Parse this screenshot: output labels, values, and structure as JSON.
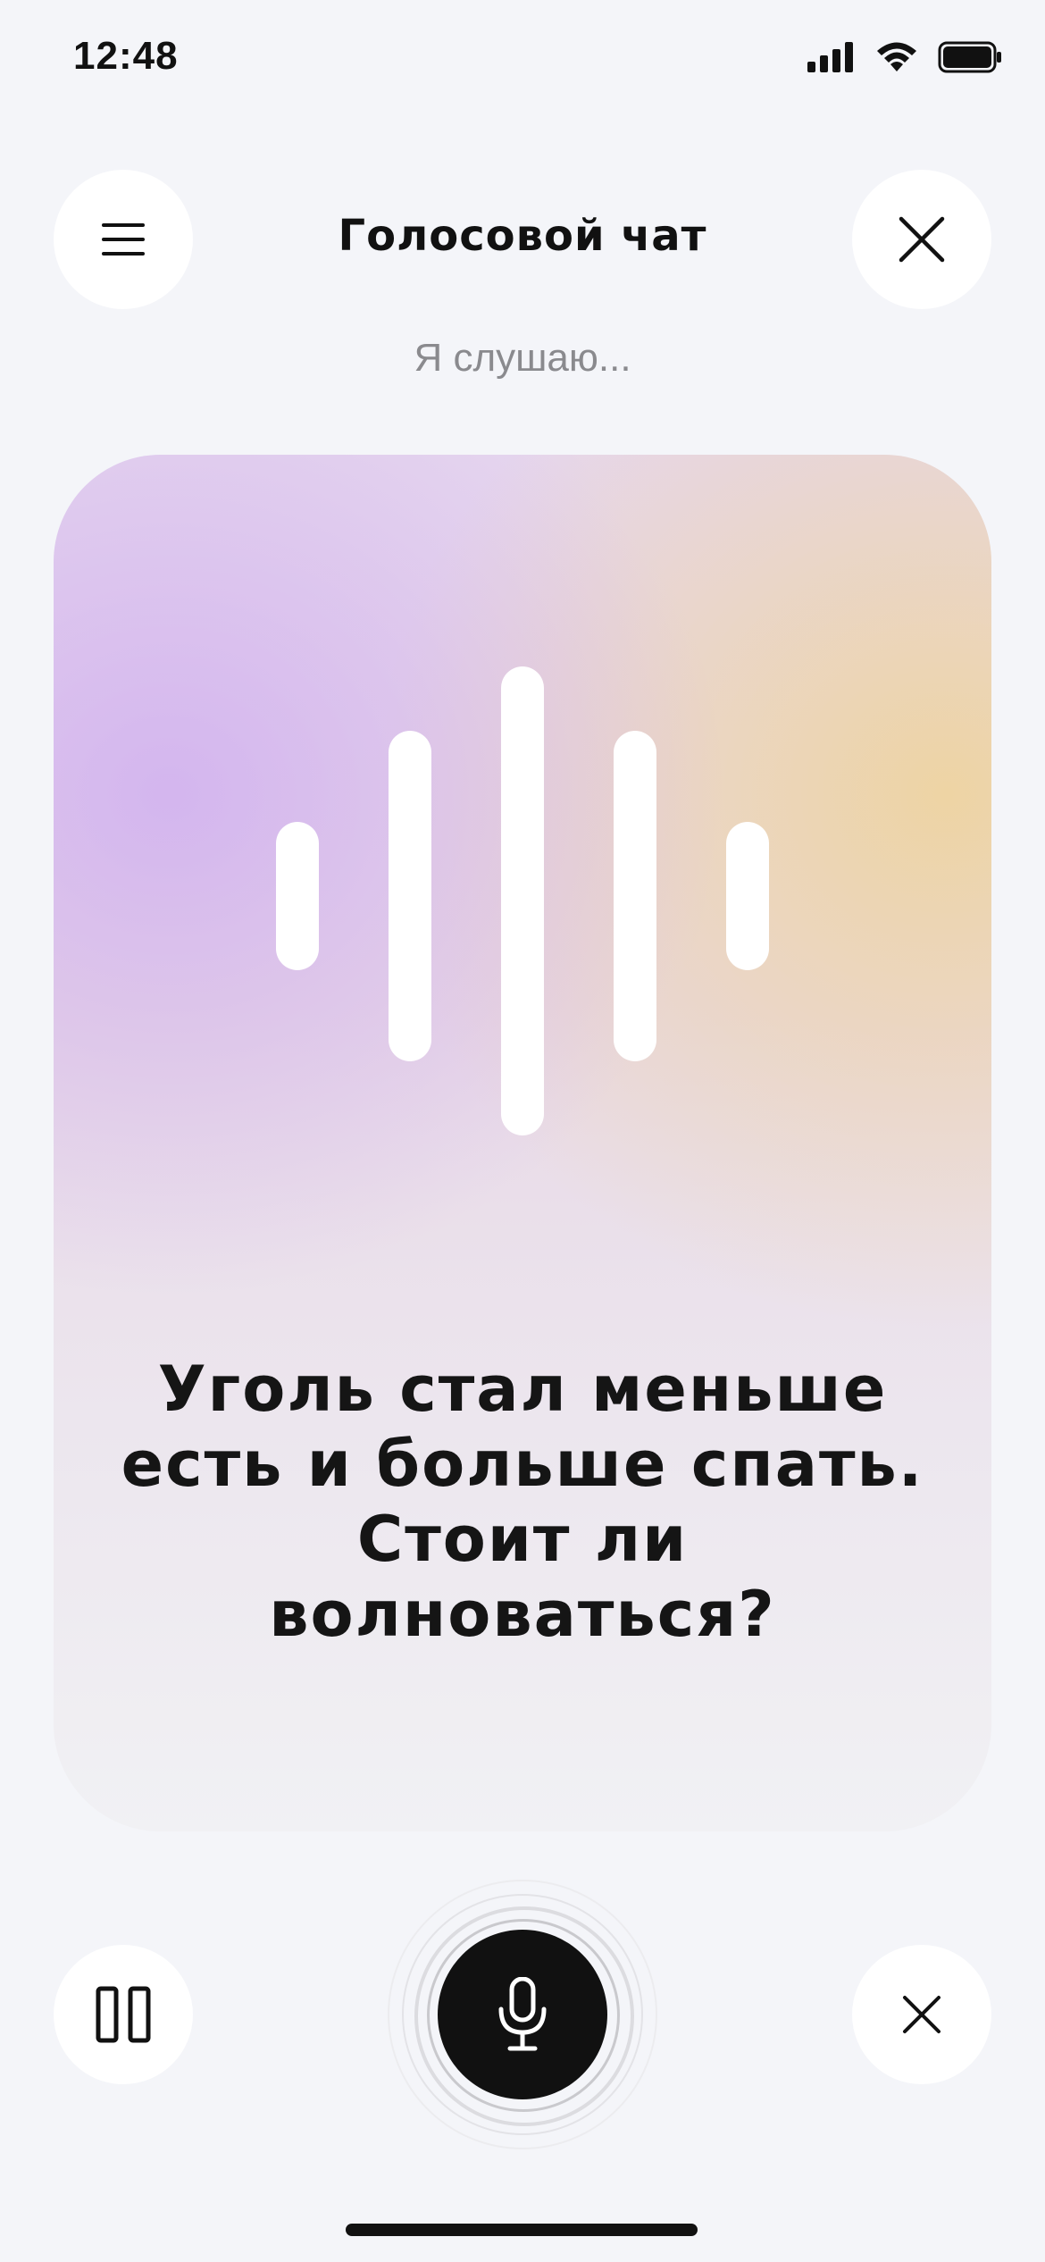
{
  "status_bar": {
    "time": "12:48"
  },
  "header": {
    "title": "Голосовой чат",
    "menu_icon": "hamburger-menu-icon",
    "close_icon": "close-icon"
  },
  "listening_status": "Я слушаю...",
  "card": {
    "question_lines": [
      "Уголь стал меньше",
      "есть и больше спать.",
      "Стоит ли",
      "волноваться?"
    ],
    "gradient_colors": [
      "#cdaaf0",
      "#eed4a0",
      "#f1f1f4"
    ]
  },
  "controls": {
    "pause_icon": "pause-icon",
    "mic_icon": "microphone-icon",
    "cancel_icon": "close-icon"
  },
  "colors": {
    "background": "#f4f5f9",
    "accent_dark": "#111111",
    "muted_text": "#8a8a8e"
  }
}
